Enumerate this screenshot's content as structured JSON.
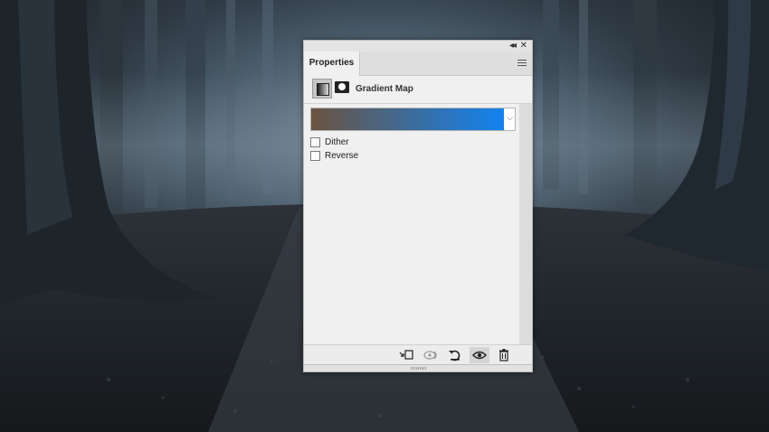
{
  "panel": {
    "collapse_glyph": "◂◂",
    "close_glyph": "✕",
    "tab_label": "Properties",
    "menu_icon": "hamburger-menu-icon",
    "adjustment_title": "Gradient Map",
    "adjustment_icon": "gradient-map-adjustment-icon",
    "mask_icon": "layer-mask-icon"
  },
  "gradient": {
    "start_color": "#6b5340",
    "end_color": "#1283f0",
    "dropdown_glyph": "⌵"
  },
  "options": {
    "dither_label": "Dither",
    "dither_checked": false,
    "reverse_label": "Reverse",
    "reverse_checked": false
  },
  "footer": {
    "icons": [
      "clip-to-layer-icon",
      "view-previous-state-icon",
      "reset-icon",
      "visibility-eye-icon",
      "trash-icon"
    ],
    "active_icon": "visibility-eye-icon"
  }
}
